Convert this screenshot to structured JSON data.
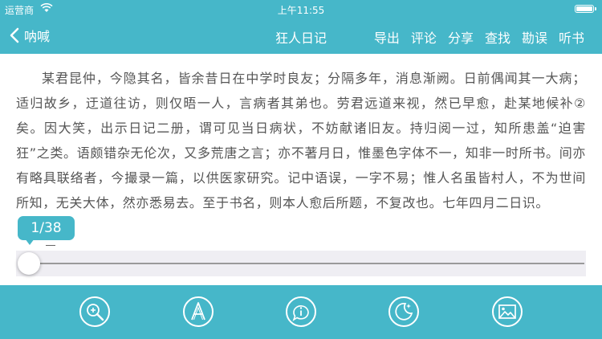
{
  "status_bar": {
    "carrier": "运营商",
    "time": "上午11:55"
  },
  "nav": {
    "back_label": "呐喊",
    "title": "狂人日记",
    "actions": [
      "导出",
      "评论",
      "分享",
      "查找",
      "勘误",
      "听书"
    ]
  },
  "content": {
    "paragraph": "某君昆仲，今隐其名，皆余昔日在中学时良友；分隔多年，消息渐阙。日前偶闻其一大病；适归故乡，迂道往访，则仅晤一人，言病者其弟也。劳君远道来视，然已早愈，赴某地候补②矣。因大笑，出示日记二册，谓可见当日病状，不妨献诸旧友。持归阅一过，知所患盖“迫害狂”之类。语颇错杂无伦次，又多荒唐之言；亦不著月日，惟墨色字体不一，知非一时所书。间亦有略具联络者，今撮录一篇，以供医家研究。记中语误，一字不易；惟人名虽皆村人，不为世间所知，无关大体，然亦悉易去。至于书名，则本人愈后所题，不复改也。七年四月二日识。"
  },
  "pager": {
    "indicator": "1/38",
    "current_page": 1,
    "total_pages": 38
  },
  "toolbar": {
    "icons": [
      "zoom-icon",
      "font-icon",
      "info-icon",
      "night-mode-icon",
      "image-icon"
    ]
  },
  "colors": {
    "accent": "#46b7c9",
    "text": "#555555",
    "slider_bg": "#efeef3"
  }
}
